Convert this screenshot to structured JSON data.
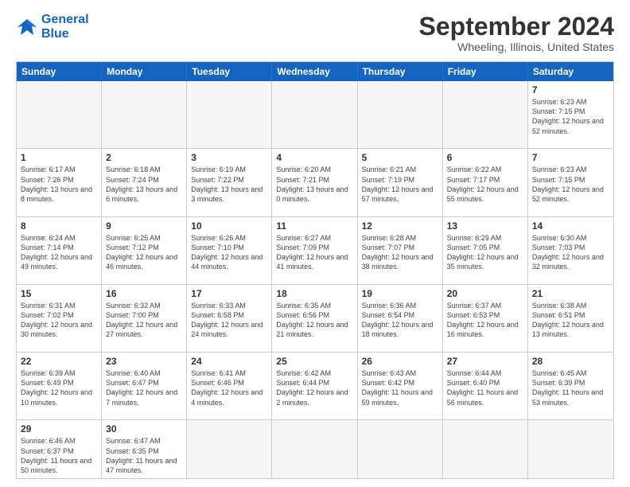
{
  "header": {
    "logo": {
      "line1": "General",
      "line2": "Blue"
    },
    "title": "September 2024",
    "location": "Wheeling, Illinois, United States"
  },
  "calendar": {
    "days_of_week": [
      "Sunday",
      "Monday",
      "Tuesday",
      "Wednesday",
      "Thursday",
      "Friday",
      "Saturday"
    ],
    "weeks": [
      [
        {
          "day": null
        },
        {
          "day": null
        },
        {
          "day": null
        },
        {
          "day": null
        },
        {
          "day": null
        },
        {
          "day": null
        },
        {
          "day": "7",
          "sunrise": "6:23 AM",
          "sunset": "7:15 PM",
          "daylight": "12 hours and 52 minutes."
        }
      ],
      [
        {
          "day": "1",
          "sunrise": "6:17 AM",
          "sunset": "7:26 PM",
          "daylight": "13 hours and 8 minutes."
        },
        {
          "day": "2",
          "sunrise": "6:18 AM",
          "sunset": "7:24 PM",
          "daylight": "13 hours and 6 minutes."
        },
        {
          "day": "3",
          "sunrise": "6:19 AM",
          "sunset": "7:22 PM",
          "daylight": "13 hours and 3 minutes."
        },
        {
          "day": "4",
          "sunrise": "6:20 AM",
          "sunset": "7:21 PM",
          "daylight": "13 hours and 0 minutes."
        },
        {
          "day": "5",
          "sunrise": "6:21 AM",
          "sunset": "7:19 PM",
          "daylight": "12 hours and 57 minutes."
        },
        {
          "day": "6",
          "sunrise": "6:22 AM",
          "sunset": "7:17 PM",
          "daylight": "12 hours and 55 minutes."
        },
        {
          "day": "7",
          "sunrise": "6:23 AM",
          "sunset": "7:15 PM",
          "daylight": "12 hours and 52 minutes."
        }
      ],
      [
        {
          "day": "8",
          "sunrise": "6:24 AM",
          "sunset": "7:14 PM",
          "daylight": "12 hours and 49 minutes."
        },
        {
          "day": "9",
          "sunrise": "6:25 AM",
          "sunset": "7:12 PM",
          "daylight": "12 hours and 46 minutes."
        },
        {
          "day": "10",
          "sunrise": "6:26 AM",
          "sunset": "7:10 PM",
          "daylight": "12 hours and 44 minutes."
        },
        {
          "day": "11",
          "sunrise": "6:27 AM",
          "sunset": "7:09 PM",
          "daylight": "12 hours and 41 minutes."
        },
        {
          "day": "12",
          "sunrise": "6:28 AM",
          "sunset": "7:07 PM",
          "daylight": "12 hours and 38 minutes."
        },
        {
          "day": "13",
          "sunrise": "6:29 AM",
          "sunset": "7:05 PM",
          "daylight": "12 hours and 35 minutes."
        },
        {
          "day": "14",
          "sunrise": "6:30 AM",
          "sunset": "7:03 PM",
          "daylight": "12 hours and 32 minutes."
        }
      ],
      [
        {
          "day": "15",
          "sunrise": "6:31 AM",
          "sunset": "7:02 PM",
          "daylight": "12 hours and 30 minutes."
        },
        {
          "day": "16",
          "sunrise": "6:32 AM",
          "sunset": "7:00 PM",
          "daylight": "12 hours and 27 minutes."
        },
        {
          "day": "17",
          "sunrise": "6:33 AM",
          "sunset": "6:58 PM",
          "daylight": "12 hours and 24 minutes."
        },
        {
          "day": "18",
          "sunrise": "6:35 AM",
          "sunset": "6:56 PM",
          "daylight": "12 hours and 21 minutes."
        },
        {
          "day": "19",
          "sunrise": "6:36 AM",
          "sunset": "6:54 PM",
          "daylight": "12 hours and 18 minutes."
        },
        {
          "day": "20",
          "sunrise": "6:37 AM",
          "sunset": "6:53 PM",
          "daylight": "12 hours and 16 minutes."
        },
        {
          "day": "21",
          "sunrise": "6:38 AM",
          "sunset": "6:51 PM",
          "daylight": "12 hours and 13 minutes."
        }
      ],
      [
        {
          "day": "22",
          "sunrise": "6:39 AM",
          "sunset": "6:49 PM",
          "daylight": "12 hours and 10 minutes."
        },
        {
          "day": "23",
          "sunrise": "6:40 AM",
          "sunset": "6:47 PM",
          "daylight": "12 hours and 7 minutes."
        },
        {
          "day": "24",
          "sunrise": "6:41 AM",
          "sunset": "6:46 PM",
          "daylight": "12 hours and 4 minutes."
        },
        {
          "day": "25",
          "sunrise": "6:42 AM",
          "sunset": "6:44 PM",
          "daylight": "12 hours and 2 minutes."
        },
        {
          "day": "26",
          "sunrise": "6:43 AM",
          "sunset": "6:42 PM",
          "daylight": "11 hours and 59 minutes."
        },
        {
          "day": "27",
          "sunrise": "6:44 AM",
          "sunset": "6:40 PM",
          "daylight": "11 hours and 56 minutes."
        },
        {
          "day": "28",
          "sunrise": "6:45 AM",
          "sunset": "6:39 PM",
          "daylight": "11 hours and 53 minutes."
        }
      ],
      [
        {
          "day": "29",
          "sunrise": "6:46 AM",
          "sunset": "6:37 PM",
          "daylight": "11 hours and 50 minutes."
        },
        {
          "day": "30",
          "sunrise": "6:47 AM",
          "sunset": "6:35 PM",
          "daylight": "11 hours and 47 minutes."
        },
        {
          "day": null
        },
        {
          "day": null
        },
        {
          "day": null
        },
        {
          "day": null
        },
        {
          "day": null
        }
      ]
    ]
  }
}
